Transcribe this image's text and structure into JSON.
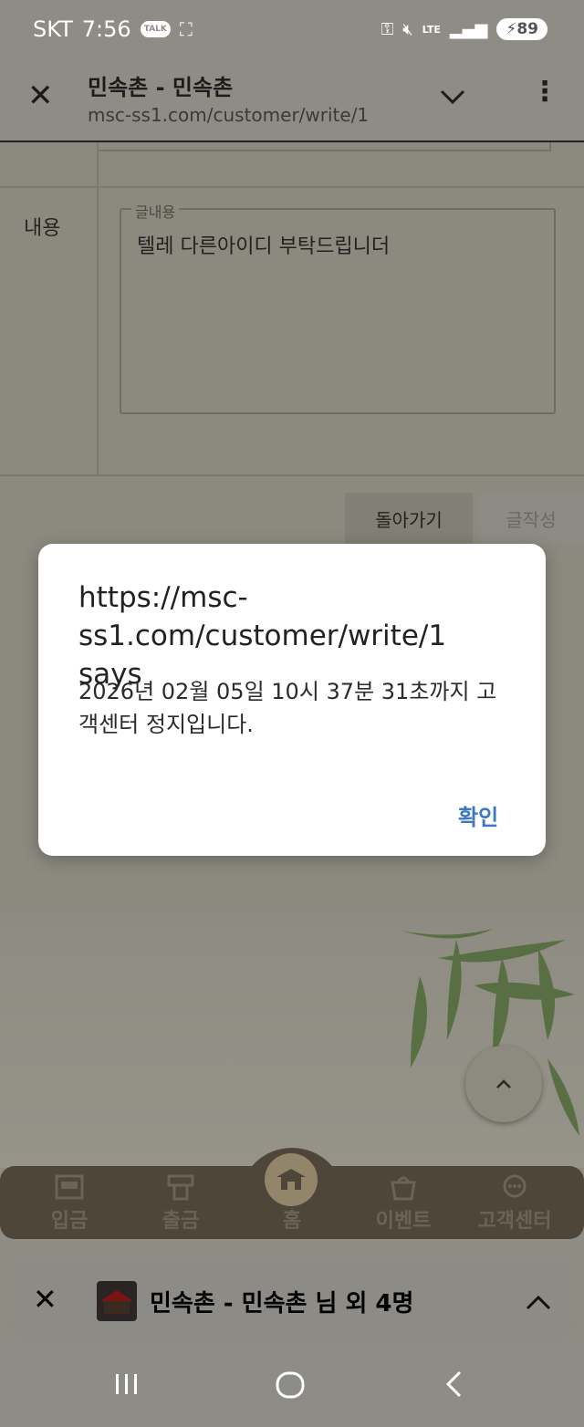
{
  "status_bar": {
    "carrier": "SKT",
    "time": "7:56",
    "talk_badge": "TALK",
    "network": "LTE",
    "battery": "89"
  },
  "browser": {
    "title": "민속촌 - 민속촌",
    "url": "msc-ss1.com/customer/write/1"
  },
  "form": {
    "content_label": "내용",
    "field_legend": "글내용",
    "field_value": "텔레 다른아이디 부탁드립니더",
    "back_button": "돌아가기",
    "write_button": "글작성"
  },
  "dialog": {
    "title": "https://msc-ss1.com/customer/write/1 says",
    "message": "2026년 02월 05일 10시 37분 31초까지 고객센터 정지입니다.",
    "ok_button": "확인"
  },
  "bottom_nav": {
    "items": [
      {
        "label": "입금",
        "icon": "deposit-icon"
      },
      {
        "label": "출금",
        "icon": "withdraw-icon"
      },
      {
        "label": "홈",
        "icon": "home-icon"
      },
      {
        "label": "이벤트",
        "icon": "event-icon"
      },
      {
        "label": "고객센터",
        "icon": "support-icon"
      }
    ]
  },
  "sheet": {
    "title": "민속촌 - 민속촌 님 외 4명"
  },
  "colors": {
    "accent_blue": "#3d78bd",
    "nav_bg": "#4e4639",
    "scrim": "#8f8c83"
  }
}
